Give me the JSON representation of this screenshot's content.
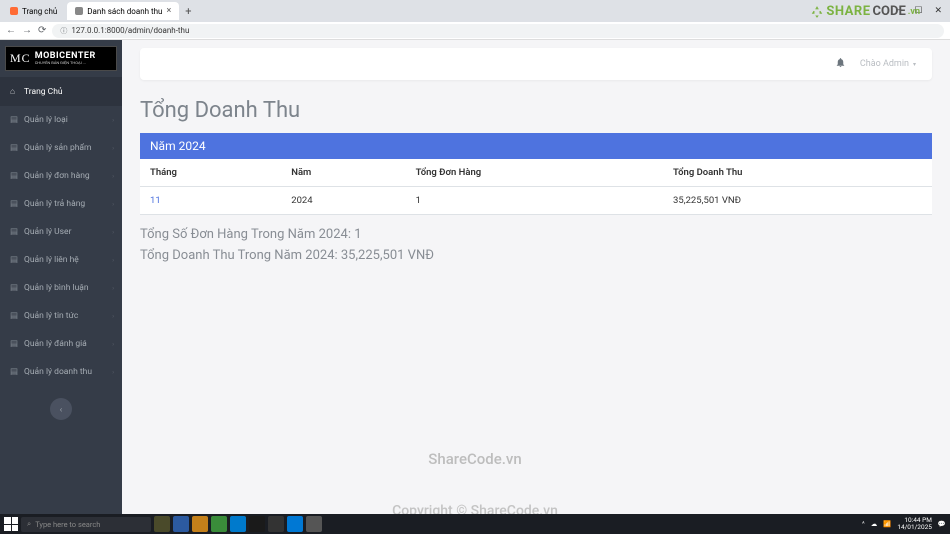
{
  "browser": {
    "tab1": "Trang chủ",
    "tab2": "Danh sách doanh thu",
    "url": "127.0.0.1:8000/admin/doanh-thu"
  },
  "watermark": {
    "share": "SHARE",
    "code": "CODE",
    "vn": ".vn",
    "center1": "ShareCode.vn",
    "center2": "Copyright © ShareCode.vn"
  },
  "logo": {
    "mc": "MC",
    "main": "MOBICENTER",
    "sub": "CHUYÊN BÁN ĐIỆN THOẠI ..."
  },
  "sidebar": {
    "items": [
      {
        "label": "Trang Chủ",
        "icon": "⌂",
        "active": true,
        "chev": false
      },
      {
        "label": "Quản lý loại",
        "icon": "▤",
        "chev": true
      },
      {
        "label": "Quản lý sản phẩm",
        "icon": "▤",
        "chev": true
      },
      {
        "label": "Quản lý đơn hàng",
        "icon": "▤",
        "chev": true
      },
      {
        "label": "Quản lý trả hàng",
        "icon": "▤",
        "chev": true
      },
      {
        "label": "Quản lý User",
        "icon": "▤",
        "chev": true
      },
      {
        "label": "Quản lý liên hệ",
        "icon": "▤",
        "chev": true
      },
      {
        "label": "Quản lý bình luận",
        "icon": "▤",
        "chev": true
      },
      {
        "label": "Quản lý tin tức",
        "icon": "▤",
        "chev": true
      },
      {
        "label": "Quản lý đánh giá",
        "icon": "▤",
        "chev": true
      },
      {
        "label": "Quản lý doanh thu",
        "icon": "▤",
        "chev": true
      }
    ]
  },
  "topbar": {
    "greet": "Chào Admin"
  },
  "page": {
    "title": "Tổng Doanh Thu",
    "year_label": "Năm 2024"
  },
  "table": {
    "headers": {
      "month": "Tháng",
      "year": "Năm",
      "orders": "Tổng Đơn Hàng",
      "revenue": "Tổng Doanh Thu"
    },
    "rows": [
      {
        "month": "11",
        "year": "2024",
        "orders": "1",
        "revenue": "35,225,501 VNĐ"
      }
    ]
  },
  "summary": {
    "line1": "Tổng Số Đơn Hàng Trong Năm 2024: 1",
    "line2": "Tổng Doanh Thu Trong Năm 2024: 35,225,501 VNĐ"
  },
  "taskbar": {
    "search_placeholder": "Type here to search",
    "time": "10:44 PM",
    "date": "14/01/2025"
  }
}
